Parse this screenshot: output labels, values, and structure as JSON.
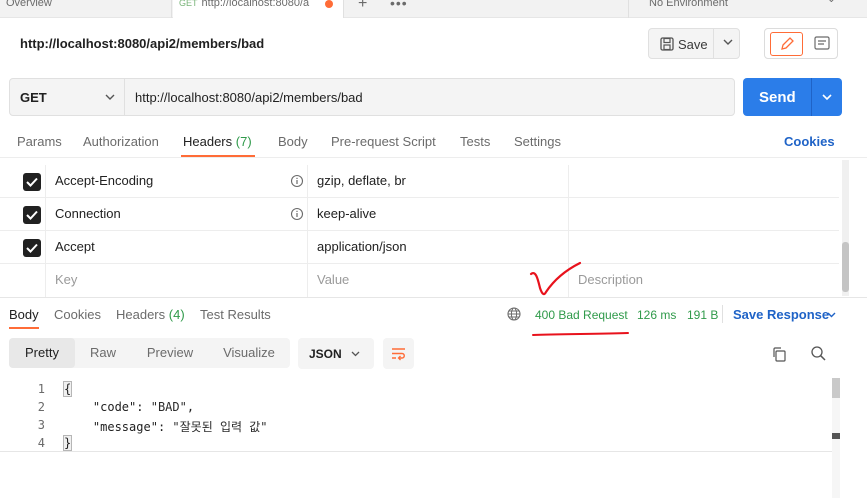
{
  "top_tabs": {
    "overview": "Overview",
    "active_method": "GET",
    "active_label": "http://localhost:8080/a",
    "plus": "+",
    "more": "•••",
    "environment": "No Environment"
  },
  "request": {
    "title": "http://localhost:8080/api2/members/bad",
    "method": "GET",
    "url": "http://localhost:8080/api2/members/bad",
    "save_label": "Save",
    "send_label": "Send"
  },
  "request_tabs": {
    "params": "Params",
    "authorization": "Authorization",
    "headers": "Headers",
    "headers_count": "(7)",
    "body": "Body",
    "prerequest": "Pre-request Script",
    "tests": "Tests",
    "settings": "Settings",
    "cookies": "Cookies"
  },
  "headers_table": {
    "rows": [
      {
        "key": "Accept-Encoding",
        "value": "gzip, deflate, br",
        "checked": true
      },
      {
        "key": "Connection",
        "value": "keep-alive",
        "checked": true
      },
      {
        "key": "Accept",
        "value": "application/json",
        "checked": true
      }
    ],
    "placeholder_key": "Key",
    "placeholder_value": "Value",
    "placeholder_description": "Description"
  },
  "response_tabs": {
    "body": "Body",
    "cookies": "Cookies",
    "headers": "Headers",
    "headers_count": "(4)",
    "test_results": "Test Results"
  },
  "response_meta": {
    "status": "400 Bad Request",
    "time": "126 ms",
    "size": "191 B",
    "save_response": "Save Response"
  },
  "view_modes": {
    "pretty": "Pretty",
    "raw": "Raw",
    "preview": "Preview",
    "visualize": "Visualize",
    "format": "JSON"
  },
  "code": {
    "lines": [
      "1",
      "2",
      "3",
      "4"
    ],
    "open_brace": "{",
    "close_brace": "}",
    "key_code": "\"code\"",
    "val_code": "\"BAD\"",
    "key_message": "\"message\"",
    "val_message": "\"잘못된 입력 값\""
  },
  "colors": {
    "accent": "#ff6c37",
    "send": "#2b7de9",
    "status_green": "#2f9a4a",
    "link_blue": "#1f63c7",
    "annotation_red": "#e8121c"
  },
  "icons": [
    "save-icon",
    "chevron-down-icon",
    "pencil-icon",
    "document-icon",
    "info-icon",
    "checkbox-icon",
    "globe-icon",
    "wrap-icon",
    "copy-icon",
    "search-icon"
  ]
}
